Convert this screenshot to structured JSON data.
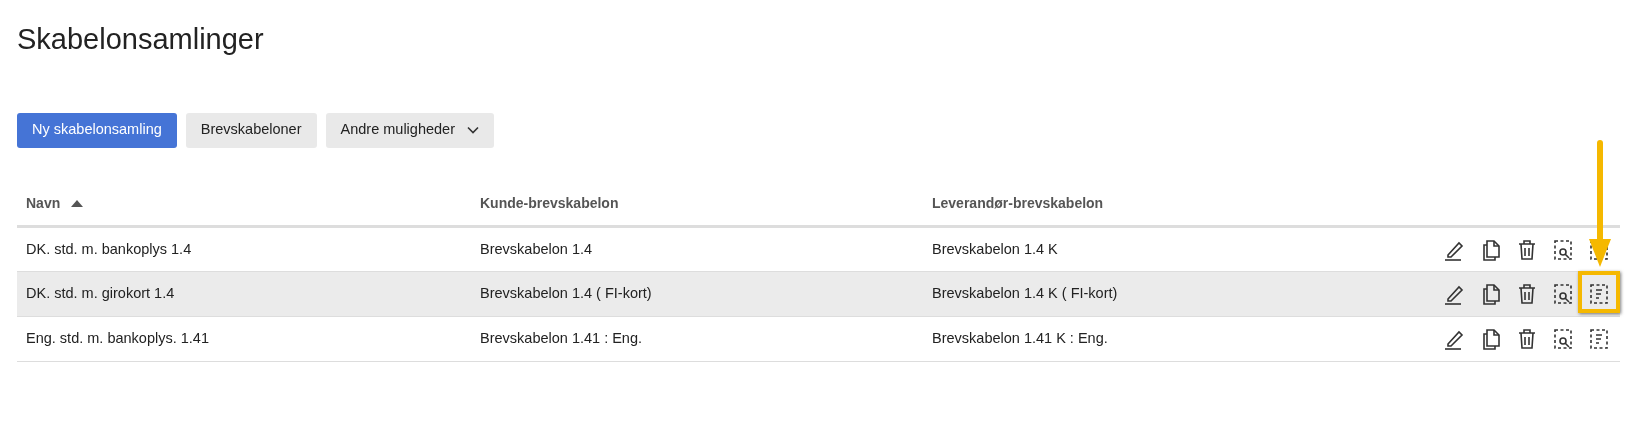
{
  "title": "Skabelonsamlinger",
  "toolbar": [
    {
      "label": "Ny skabelonsamling",
      "kind": "primary"
    },
    {
      "label": "Brevskabeloner",
      "kind": "secondary"
    },
    {
      "label": "Andre muligheder",
      "kind": "dropdown"
    }
  ],
  "table": {
    "columns": [
      {
        "label": "Navn",
        "sorted": true
      },
      {
        "label": "Kunde-brevskabelon"
      },
      {
        "label": "Leverandør-brevskabelon"
      }
    ],
    "rows": [
      {
        "cells": [
          "DK. std. m. bankoplys 1.4",
          "Brevskabelon 1.4",
          "Brevskabelon 1.4 K"
        ],
        "highlighted": false,
        "callout": false
      },
      {
        "cells": [
          "DK. std. m. girokort 1.4",
          "Brevskabelon 1.4 ( FI-kort)",
          "Brevskabelon 1.4 K ( FI-kort)"
        ],
        "highlighted": true,
        "callout": true
      },
      {
        "cells": [
          "Eng. std. m. bankoplys. 1.41",
          "Brevskabelon 1.41 : Eng.",
          "Brevskabelon 1.41 K : Eng."
        ],
        "highlighted": false,
        "callout": false
      }
    ]
  }
}
